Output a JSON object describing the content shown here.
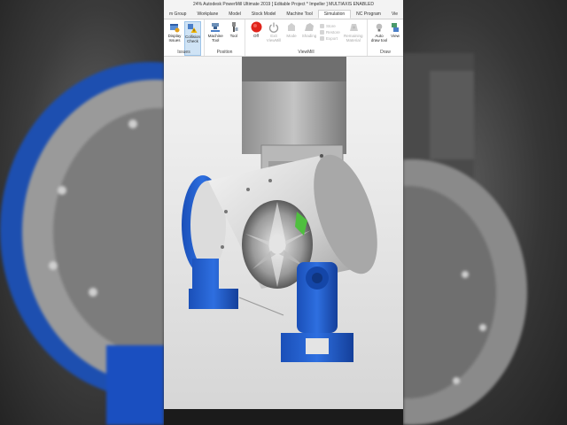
{
  "window": {
    "title": "24% Autodesk PowerMill Ultimate 2019   [ Editable Project * Impeller ]   MULTIAXIS ENABLED"
  },
  "tabs": [
    {
      "label": "m Group"
    },
    {
      "label": "Workplane"
    },
    {
      "label": "Model"
    },
    {
      "label": "Stock Model"
    },
    {
      "label": "Machine Tool"
    },
    {
      "label": "Simulation"
    },
    {
      "label": "NC Program"
    },
    {
      "label": "Vie"
    }
  ],
  "ribbon": {
    "issues": {
      "label": "Issues",
      "display_issues": "Display Issues",
      "collision_check": "Collision Check"
    },
    "position": {
      "label": "Position",
      "machine_tool": "Machine Tool",
      "tool": "Tool"
    },
    "viewmill": {
      "label": "ViewMill",
      "off": "Off",
      "exit_viewmill": "Exit ViewMill",
      "mode": "Mode",
      "shading": "Shading",
      "store": "Store",
      "restore": "Restore",
      "export": "Export",
      "remaining_material": "Remaining Material"
    },
    "draw": {
      "label": "Draw",
      "auto_draw_tool": "Auto draw tool",
      "view": "View"
    }
  },
  "colors": {
    "accent": "#1f6fd6",
    "machine_blue": "#1a5fd0",
    "cutter_red": "#d9302a",
    "stop_red": "#e0241b"
  },
  "icons": [
    "display-issues-icon",
    "collision-check-icon",
    "machine-tool-icon",
    "tool-icon",
    "stop-icon",
    "power-icon",
    "mode-icon",
    "shading-icon",
    "store-icon",
    "restore-icon",
    "export-icon",
    "remaining-material-icon",
    "lightbulb-icon",
    "view-icon"
  ]
}
